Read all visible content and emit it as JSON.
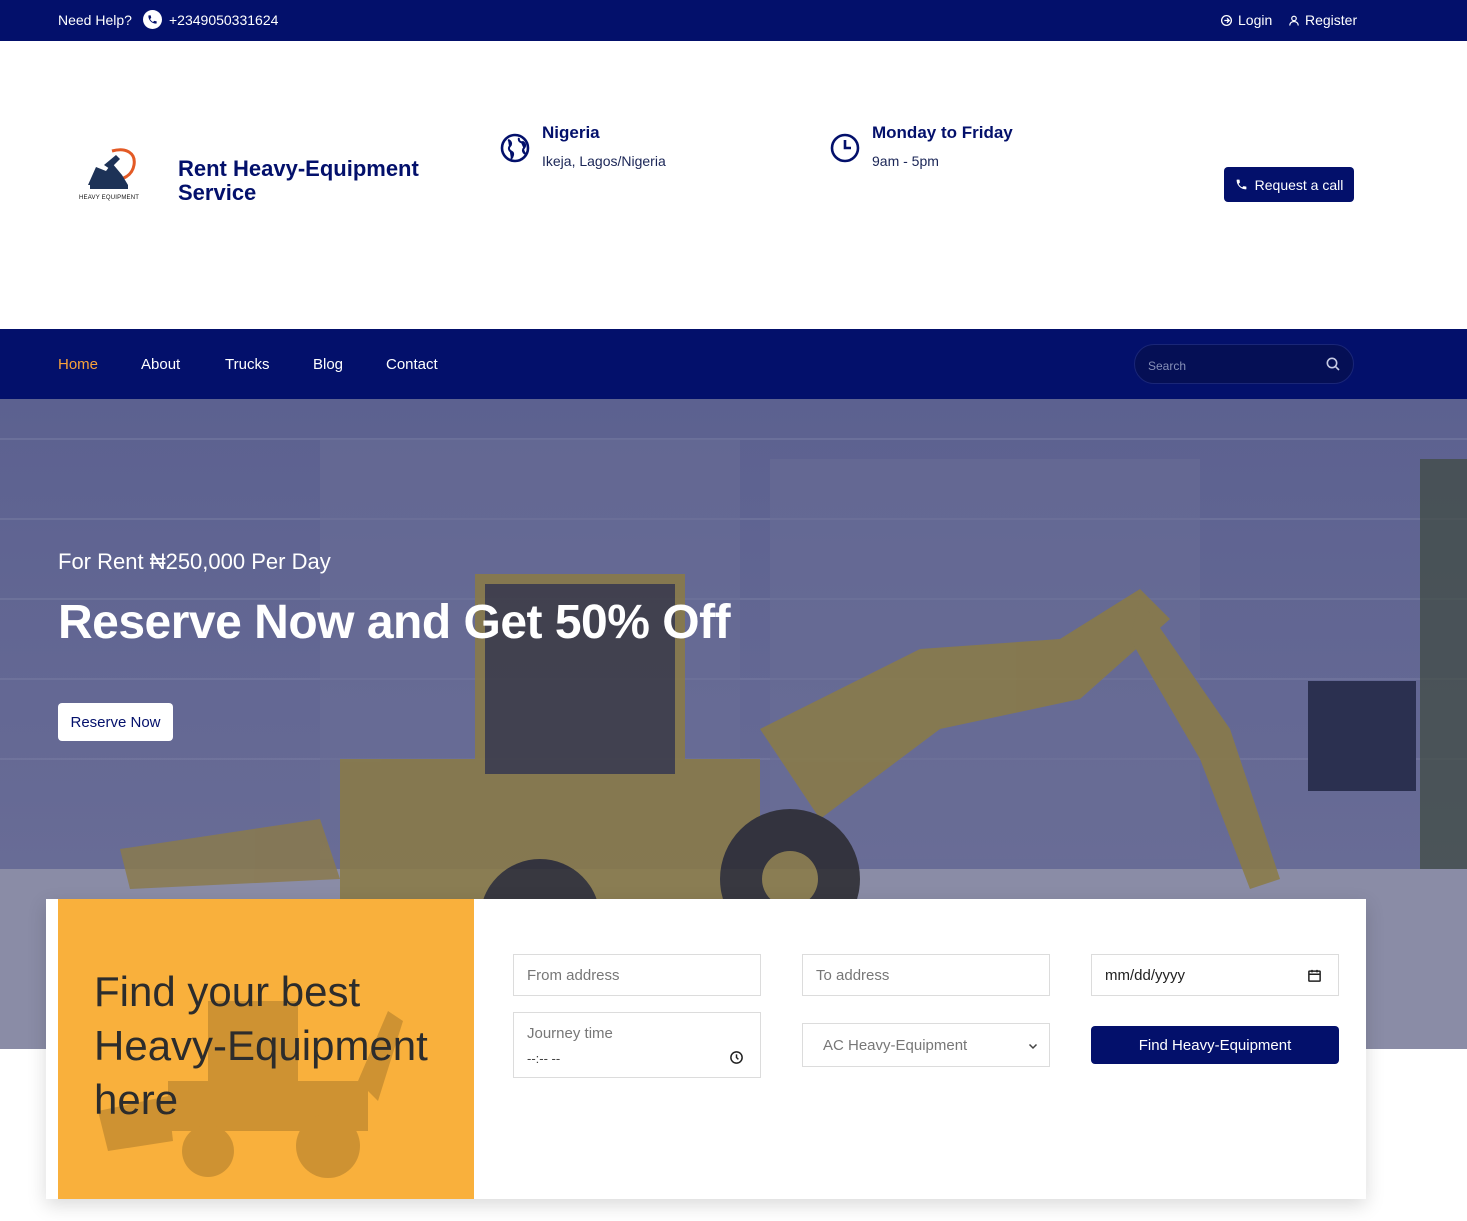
{
  "topbar": {
    "help_label": "Need Help?",
    "phone": "+2349050331624",
    "login_label": "Login",
    "register_label": "Register"
  },
  "header": {
    "logo_caption": "HEAVY EQUIPMENT",
    "brand_name": "Rent Heavy-Equipment Service",
    "location_title": "Nigeria",
    "location_sub": "Ikeja, Lagos/Nigeria",
    "hours_title": "Monday to Friday",
    "hours_sub": "9am - 5pm",
    "request_call_label": "Request a call"
  },
  "nav": {
    "items": [
      {
        "label": "Home",
        "active": true
      },
      {
        "label": "About",
        "active": false
      },
      {
        "label": "Trucks",
        "active": false
      },
      {
        "label": "Blog",
        "active": false
      },
      {
        "label": "Contact",
        "active": false
      }
    ],
    "search_placeholder": "Search"
  },
  "hero": {
    "subtitle": "For Rent ₦250,000 Per Day",
    "title": "Reserve Now and Get 50% Off",
    "button_label": "Reserve Now"
  },
  "booking": {
    "heading": "Find your best Heavy-Equipment here",
    "from_placeholder": "From address",
    "to_placeholder": "To address",
    "date_placeholder": "mm/dd/yyyy",
    "journey_label": "Journey time",
    "journey_value": "--:-- --",
    "equipment_selected": "AC Heavy-Equipment",
    "find_button_label": "Find Heavy-Equipment"
  },
  "colors": {
    "navy": "#03106b",
    "accent_orange": "#f8a23a",
    "panel_orange": "#f9b03c"
  }
}
